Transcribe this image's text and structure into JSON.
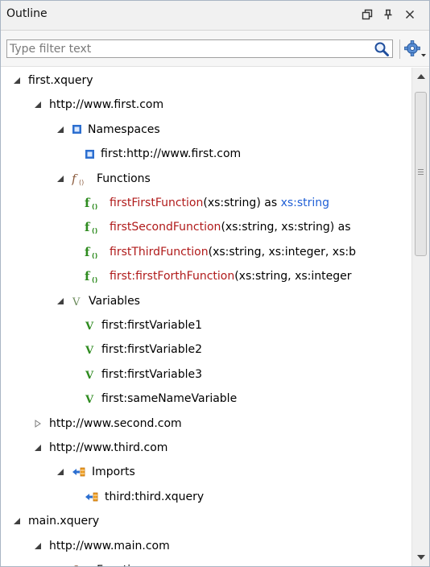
{
  "window": {
    "title": "Outline"
  },
  "filter": {
    "placeholder": "Type filter text",
    "value": ""
  },
  "tree": [
    {
      "depth": 0,
      "state": "expanded",
      "icon": "none-icon",
      "parts": [
        {
          "text": "first.xquery",
          "style": "plain"
        }
      ]
    },
    {
      "depth": 1,
      "state": "expanded",
      "icon": "none-icon",
      "parts": [
        {
          "text": "http://www.first.com",
          "style": "plain"
        }
      ]
    },
    {
      "depth": 2,
      "state": "expanded",
      "icon": "namespace-icon",
      "parts": [
        {
          "text": "Namespaces",
          "style": "plain"
        }
      ]
    },
    {
      "depth": 3,
      "state": "leaf",
      "icon": "namespace-icon",
      "parts": [
        {
          "text": "first:http://www.first.com",
          "style": "plain"
        }
      ]
    },
    {
      "depth": 2,
      "state": "expanded",
      "icon": "functions-group-icon",
      "parts": [
        {
          "text": "Functions",
          "style": "plain"
        }
      ]
    },
    {
      "depth": 3,
      "state": "leaf",
      "icon": "function-icon",
      "parts": [
        {
          "text": "firstFirstFunction",
          "style": "fname"
        },
        {
          "text": "(xs:string) as ",
          "style": "plain"
        },
        {
          "text": "xs:string",
          "style": "ftype"
        }
      ]
    },
    {
      "depth": 3,
      "state": "leaf",
      "icon": "function-icon",
      "parts": [
        {
          "text": "firstSecondFunction",
          "style": "fname"
        },
        {
          "text": "(xs:string, xs:string) as",
          "style": "plain"
        }
      ]
    },
    {
      "depth": 3,
      "state": "leaf",
      "icon": "function-icon",
      "parts": [
        {
          "text": "firstThirdFunction",
          "style": "fname"
        },
        {
          "text": "(xs:string, xs:integer, xs:b",
          "style": "plain"
        }
      ]
    },
    {
      "depth": 3,
      "state": "leaf",
      "icon": "function-icon",
      "parts": [
        {
          "text": "first:firstForthFunction",
          "style": "fname"
        },
        {
          "text": "(xs:string, xs:integer",
          "style": "plain"
        }
      ]
    },
    {
      "depth": 2,
      "state": "expanded",
      "icon": "variables-group-icon",
      "parts": [
        {
          "text": "Variables",
          "style": "plain"
        }
      ]
    },
    {
      "depth": 3,
      "state": "leaf",
      "icon": "variable-icon",
      "parts": [
        {
          "text": "first:firstVariable1",
          "style": "plain"
        }
      ]
    },
    {
      "depth": 3,
      "state": "leaf",
      "icon": "variable-icon",
      "parts": [
        {
          "text": "first:firstVariable2",
          "style": "plain"
        }
      ]
    },
    {
      "depth": 3,
      "state": "leaf",
      "icon": "variable-icon",
      "parts": [
        {
          "text": "first:firstVariable3",
          "style": "plain"
        }
      ]
    },
    {
      "depth": 3,
      "state": "leaf",
      "icon": "variable-icon",
      "parts": [
        {
          "text": "first:sameNameVariable",
          "style": "plain"
        }
      ]
    },
    {
      "depth": 1,
      "state": "collapsed",
      "icon": "none-icon",
      "parts": [
        {
          "text": "http://www.second.com",
          "style": "plain"
        }
      ]
    },
    {
      "depth": 1,
      "state": "expanded",
      "icon": "none-icon",
      "parts": [
        {
          "text": "http://www.third.com",
          "style": "plain"
        }
      ]
    },
    {
      "depth": 2,
      "state": "expanded",
      "icon": "import-icon",
      "parts": [
        {
          "text": "Imports",
          "style": "plain"
        }
      ]
    },
    {
      "depth": 3,
      "state": "leaf",
      "icon": "import-icon",
      "parts": [
        {
          "text": "third:third.xquery",
          "style": "plain"
        }
      ]
    },
    {
      "depth": 0,
      "state": "expanded",
      "icon": "none-icon",
      "parts": [
        {
          "text": "main.xquery",
          "style": "plain"
        }
      ]
    },
    {
      "depth": 1,
      "state": "expanded",
      "icon": "none-icon",
      "parts": [
        {
          "text": "http://www.main.com",
          "style": "plain"
        }
      ]
    },
    {
      "depth": 2,
      "state": "expanded",
      "icon": "functions-group-icon",
      "parts": [
        {
          "text": "Functions",
          "style": "plain"
        }
      ]
    }
  ],
  "colors": {
    "function_name": "#b01a1a",
    "type_link": "#1f5fd6",
    "icon_green": "#2e8b1f",
    "icon_blue": "#2c6fd0"
  }
}
